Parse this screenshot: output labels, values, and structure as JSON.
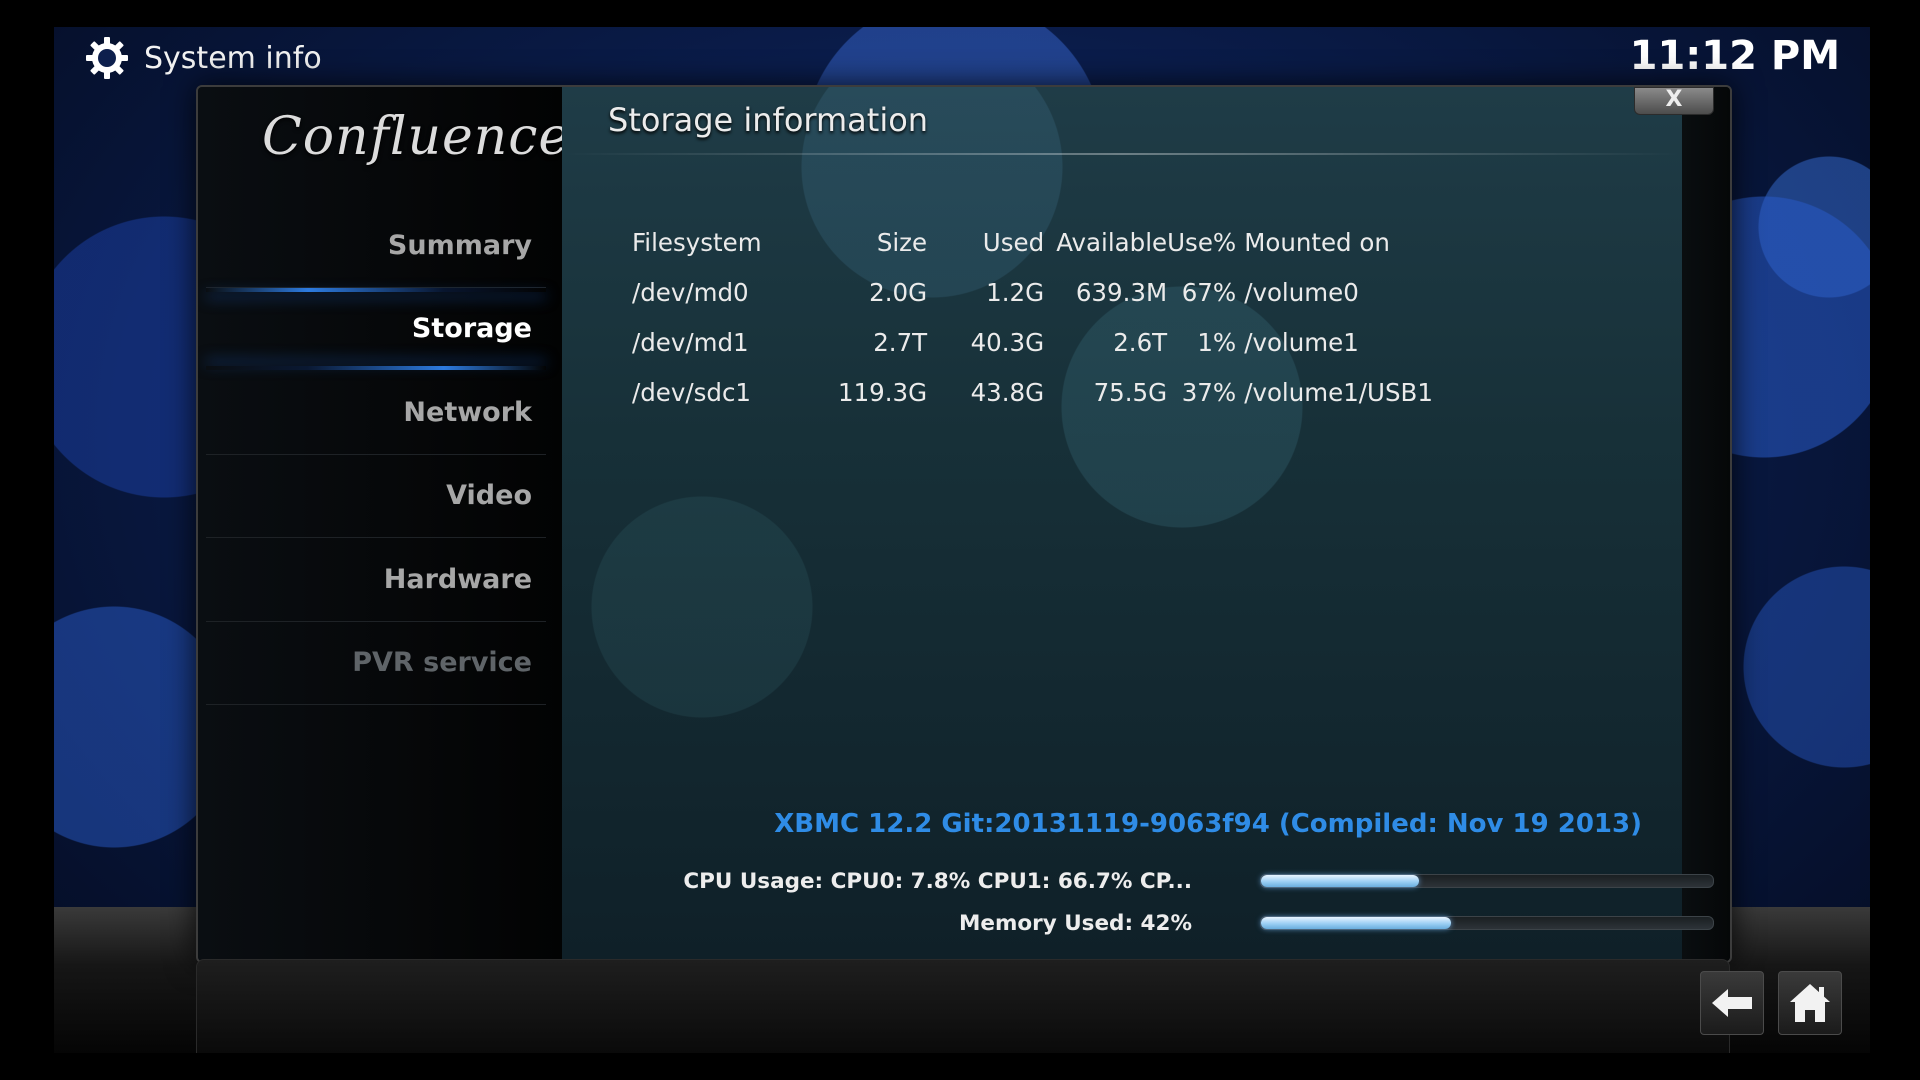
{
  "header": {
    "title": "System info",
    "title_icon": "gear-icon",
    "clock": "11:12 PM"
  },
  "sidebar": {
    "logo": "Confluence",
    "items": [
      {
        "label": "Summary",
        "state": "normal"
      },
      {
        "label": "Storage",
        "state": "selected"
      },
      {
        "label": "Network",
        "state": "normal"
      },
      {
        "label": "Video",
        "state": "normal"
      },
      {
        "label": "Hardware",
        "state": "normal"
      },
      {
        "label": "PVR service",
        "state": "disabled"
      }
    ]
  },
  "main": {
    "heading": "Storage information",
    "close_label": "X",
    "table": {
      "headers": [
        "Filesystem",
        "Size",
        "Used",
        "Available",
        "Use%",
        "Mounted on"
      ],
      "rows": [
        [
          "/dev/md0",
          "2.0G",
          "1.2G",
          "639.3M",
          "67%",
          "/volume0"
        ],
        [
          "/dev/md1",
          "2.7T",
          "40.3G",
          "2.6T",
          "1%",
          "/volume1"
        ],
        [
          "/dev/sdc1",
          "119.3G",
          "43.8G",
          "75.5G",
          "37%",
          "/volume1/USB1"
        ]
      ]
    },
    "version": "XBMC 12.2 Git:20131119-9063f94 (Compiled: Nov 19 2013)",
    "cpu": {
      "label": "CPU Usage: CPU0: 7.8% CPU1: 66.7% CP...",
      "level_percent": 35
    },
    "memory": {
      "label": "Memory Used: 42%",
      "level_percent": 42
    }
  },
  "footer": {
    "buttons": [
      "back-arrow-icon",
      "home-icon"
    ]
  },
  "colors": {
    "accent_blue": "#2f8ce6",
    "bar_fill": "#9ccff4",
    "selection_glow": "#2d7be0"
  }
}
